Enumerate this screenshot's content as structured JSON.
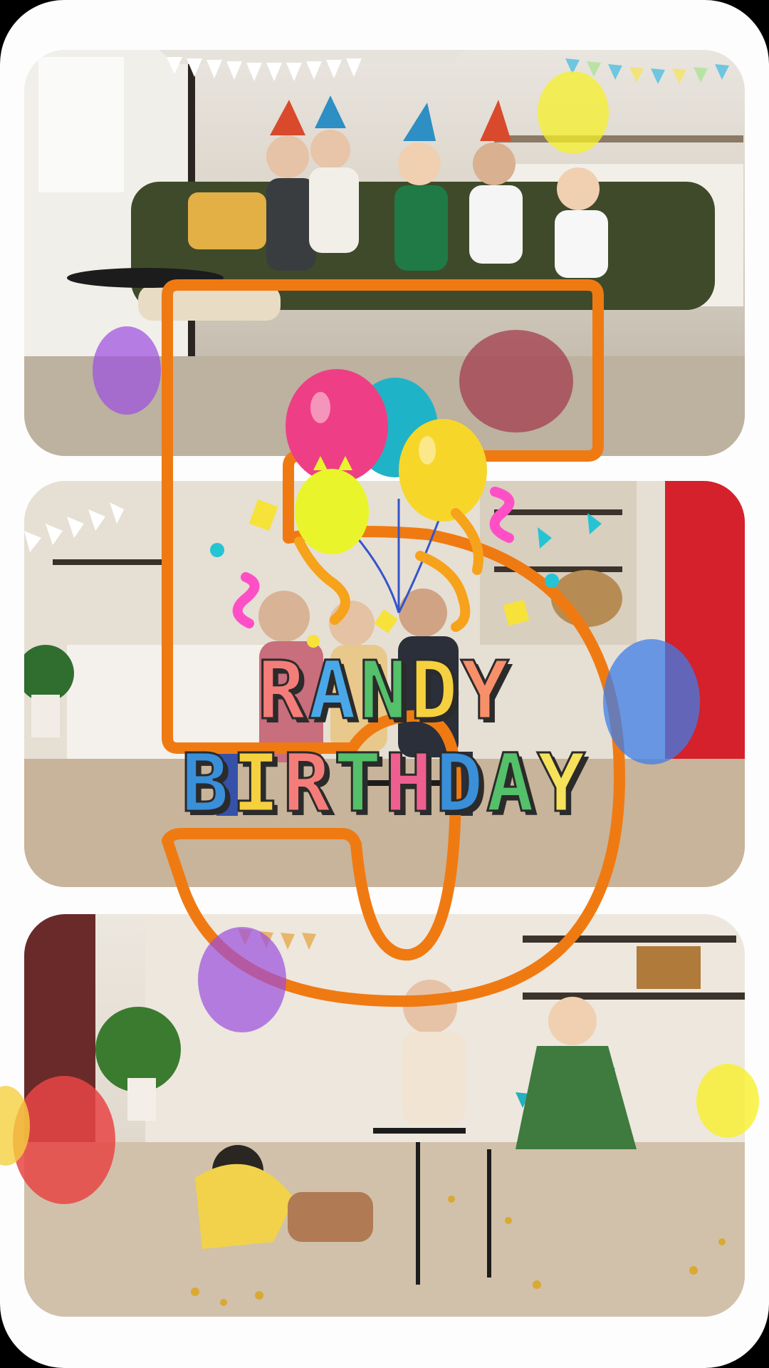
{
  "title": {
    "line1": [
      "R",
      "A",
      "N",
      "D",
      "Y"
    ],
    "line2": [
      "B",
      "I",
      "R",
      "T",
      "H",
      "D",
      "A",
      "Y"
    ]
  },
  "letter_colors": {
    "line1": [
      "#f47d7a",
      "#4aa8e8",
      "#54c06a",
      "#f5d03f",
      "#f7906a"
    ],
    "line2": [
      "#3a8fd9",
      "#f5d03f",
      "#f47d7a",
      "#54c06a",
      "#ee5f8f",
      "#3a8fd9",
      "#54c06a",
      "#f5e25a"
    ]
  },
  "decor": {
    "number_icon": "number-five-outline",
    "number_color": "#f07a12",
    "balloon_colors": [
      "#ee3f86",
      "#1fb3c8",
      "#f7d62a",
      "#e9f52a",
      "#9b4de0",
      "#e84545",
      "#3d7de8",
      "#a33d4e"
    ],
    "streamer_colors": [
      "#ff4fc6",
      "#f7a21b",
      "#f7e23a",
      "#25c4d4"
    ]
  }
}
